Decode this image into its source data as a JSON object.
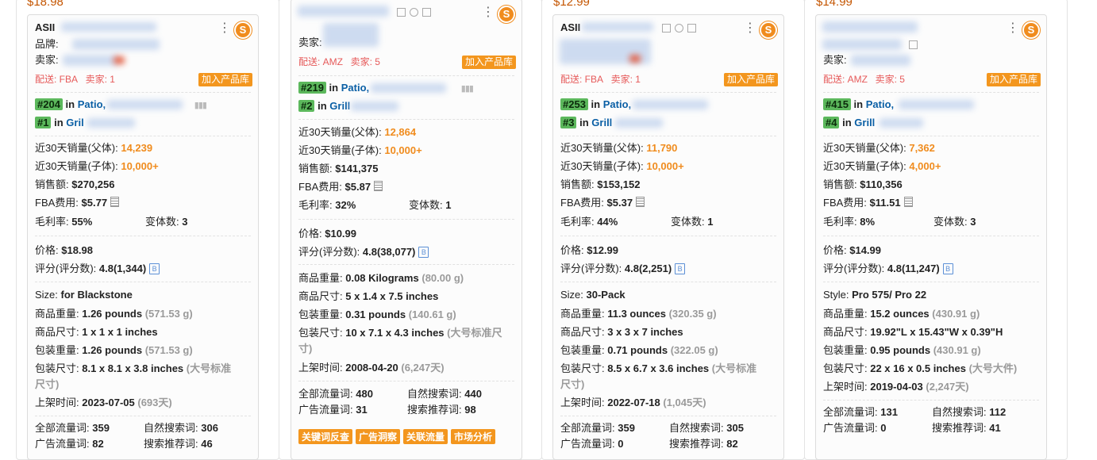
{
  "cards": [
    {
      "top_price": "$18.98",
      "asin_prefix": "ASII",
      "brand_label": "品牌: ",
      "seller_label": "卖家: ",
      "ship_tag": "配送: FBA",
      "seller_count_tag": "卖家: 1",
      "add_button": "加入产品库",
      "rank1": "#204",
      "rank1_in": "in",
      "rank1_cat": "Patio,",
      "rank2": "#1",
      "rank2_in": "in",
      "rank2_cat": "Gril",
      "sales_parent_label": "近30天销量(父体): ",
      "sales_parent": "14,239",
      "sales_child_label": "近30天销量(子体): ",
      "sales_child": "10,000+",
      "revenue_label": "销售额: ",
      "revenue": "$270,256",
      "fba_label": "FBA费用: ",
      "fba": "$5.77",
      "margin_label": "毛利率: ",
      "margin": "55%",
      "variants_label": "变体数: ",
      "variants": "3",
      "price_label": "价格: ",
      "price": "$18.98",
      "rating_label": "评分(评分数): ",
      "rating": "4.8(1,344)",
      "b_badge": "B",
      "option_label": "Size: ",
      "option_value": "for Blackstone",
      "weight_label": "商品重量: ",
      "weight": "1.26 pounds",
      "weight_alt": "(571.53 g)",
      "dim_label": "商品尺寸: ",
      "dim": "1 x 1 x 1 inches",
      "pkg_weight_label": "包装重量: ",
      "pkg_weight": "1.26 pounds",
      "pkg_weight_alt": "(571.53 g)",
      "pkg_dim_label": "包装尺寸: ",
      "pkg_dim": "8.1 x 8.1 x 3.8 inches",
      "pkg_dim_alt_1": "(大号标准",
      "pkg_dim_alt_2": "尺寸)",
      "listed_label": "上架时间: ",
      "listed": "2023-07-05",
      "listed_alt": "(693天)",
      "kw_total_label": "全部流量词: ",
      "kw_total": "359",
      "kw_natural_label": "自然搜索词: ",
      "kw_natural": "306",
      "kw_ad_label": "广告流量词: ",
      "kw_ad": "82",
      "kw_rec_label": "搜索推荐词: ",
      "kw_rec": "46"
    },
    {
      "seller_label": "卖家: ",
      "ship_tag": "配送: AMZ",
      "seller_count_tag": "卖家: 5",
      "add_button": "加入产品库",
      "rank1": "#219",
      "rank1_in": "in",
      "rank1_cat": "Patio,",
      "rank2": "#2",
      "rank2_in": "in",
      "rank2_cat": "Grill",
      "sales_parent_label": "近30天销量(父体): ",
      "sales_parent": "12,864",
      "sales_child_label": "近30天销量(子体): ",
      "sales_child": "10,000+",
      "revenue_label": "销售额: ",
      "revenue": "$141,375",
      "fba_label": "FBA费用: ",
      "fba": "$5.87",
      "margin_label": "毛利率: ",
      "margin": "32%",
      "variants_label": "变体数: ",
      "variants": "1",
      "price_label": "价格: ",
      "price": "$10.99",
      "rating_label": "评分(评分数): ",
      "rating": "4.8(38,077)",
      "b_badge": "B",
      "weight_label": "商品重量: ",
      "weight": "0.08 Kilograms",
      "weight_alt": "(80.00 g)",
      "dim_label": "商品尺寸: ",
      "dim": "5 x 1.4 x 7.5 inches",
      "pkg_weight_label": "包装重量: ",
      "pkg_weight": "0.31 pounds",
      "pkg_weight_alt": "(140.61 g)",
      "pkg_dim_label": "包装尺寸: ",
      "pkg_dim": "10 x 7.1 x 4.3 inches",
      "pkg_dim_alt_1": "(大号标准尺",
      "pkg_dim_alt_2": "寸)",
      "listed_label": "上架时间: ",
      "listed": "2008-04-20",
      "listed_alt": "(6,247天)",
      "kw_total_label": "全部流量词: ",
      "kw_total": "480",
      "kw_natural_label": "自然搜索词: ",
      "kw_natural": "440",
      "kw_ad_label": "广告流量词: ",
      "kw_ad": "31",
      "kw_rec_label": "搜索推荐词: ",
      "kw_rec": "98",
      "buttons": [
        "关键词反查",
        "广告洞察",
        "关联流量",
        "市场分析"
      ]
    },
    {
      "top_price": "$12.99",
      "asin_prefix": "ASII",
      "ship_tag": "配送: FBA",
      "seller_count_tag": "卖家: 1",
      "add_button": "加入产品库",
      "rank1": "#253",
      "rank1_in": "in",
      "rank1_cat": "Patio,",
      "rank2": "#3",
      "rank2_in": "in",
      "rank2_cat": "Grill",
      "sales_parent_label": "近30天销量(父体): ",
      "sales_parent": "11,790",
      "sales_child_label": "近30天销量(子体): ",
      "sales_child": "10,000+",
      "revenue_label": "销售额: ",
      "revenue": "$153,152",
      "fba_label": "FBA费用: ",
      "fba": "$5.37",
      "margin_label": "毛利率: ",
      "margin": "44%",
      "variants_label": "变体数: ",
      "variants": "1",
      "price_label": "价格: ",
      "price": "$12.99",
      "rating_label": "评分(评分数): ",
      "rating": "4.8(2,251)",
      "b_badge": "B",
      "option_label": "Size: ",
      "option_value": "30-Pack",
      "weight_label": "商品重量: ",
      "weight": "11.3 ounces",
      "weight_alt": "(320.35 g)",
      "dim_label": "商品尺寸: ",
      "dim": "3 x 3 x 7 inches",
      "pkg_weight_label": "包装重量: ",
      "pkg_weight": "0.71 pounds",
      "pkg_weight_alt": "(322.05 g)",
      "pkg_dim_label": "包装尺寸: ",
      "pkg_dim": "8.5 x 6.7 x 3.6 inches",
      "pkg_dim_alt_1": "(大号标准",
      "pkg_dim_alt_2": "尺寸)",
      "listed_label": "上架时间: ",
      "listed": "2022-07-18",
      "listed_alt": "(1,045天)",
      "kw_total_label": "全部流量词: ",
      "kw_total": "359",
      "kw_natural_label": "自然搜索词: ",
      "kw_natural": "305",
      "kw_ad_label": "广告流量词: ",
      "kw_ad": "0",
      "kw_rec_label": "搜索推荐词: ",
      "kw_rec": "82"
    },
    {
      "top_price": "$14.99",
      "seller_label": "卖家: ",
      "ship_tag": "配送: AMZ",
      "seller_count_tag": "卖家: 5",
      "add_button": "加入产品库",
      "rank1": "#415",
      "rank1_in": "in",
      "rank1_cat": "Patio,",
      "rank2": "#4",
      "rank2_in": "in",
      "rank2_cat": "Grill",
      "sales_parent_label": "近30天销量(父体): ",
      "sales_parent": "7,362",
      "sales_child_label": "近30天销量(子体): ",
      "sales_child": "4,000+",
      "revenue_label": "销售额: ",
      "revenue": "$110,356",
      "fba_label": "FBA费用: ",
      "fba": "$11.51",
      "margin_label": "毛利率: ",
      "margin": "8%",
      "variants_label": "变体数: ",
      "variants": "3",
      "price_label": "价格: ",
      "price": "$14.99",
      "rating_label": "评分(评分数): ",
      "rating": "4.8(11,247)",
      "b_badge": "B",
      "option_label": "Style: ",
      "option_value": "Pro 575/ Pro 22",
      "weight_label": "商品重量: ",
      "weight": "15.2 ounces",
      "weight_alt": "(430.91 g)",
      "dim_label": "商品尺寸: ",
      "dim": "19.92\"L x 15.43\"W x 0.39\"H",
      "pkg_weight_label": "包装重量: ",
      "pkg_weight": "0.95 pounds",
      "pkg_weight_alt": "(430.91 g)",
      "pkg_dim_label": "包装尺寸: ",
      "pkg_dim": "22 x 16 x 0.5 inches",
      "pkg_dim_alt_1": "(大号大件)",
      "listed_label": "上架时间: ",
      "listed": "2019-04-03",
      "listed_alt": "(2,247天)",
      "kw_total_label": "全部流量词: ",
      "kw_total": "131",
      "kw_natural_label": "自然搜索词: ",
      "kw_natural": "112",
      "kw_ad_label": "广告流量词: ",
      "kw_ad": "0",
      "kw_rec_label": "搜索推荐词: ",
      "kw_rec": "41"
    }
  ],
  "logo_letter": "S",
  "colors": {
    "accent": "#f3961e",
    "rank_green": "#5cb85c",
    "link_blue": "#0a5fa5",
    "alt_grey": "#9a9a9a"
  }
}
